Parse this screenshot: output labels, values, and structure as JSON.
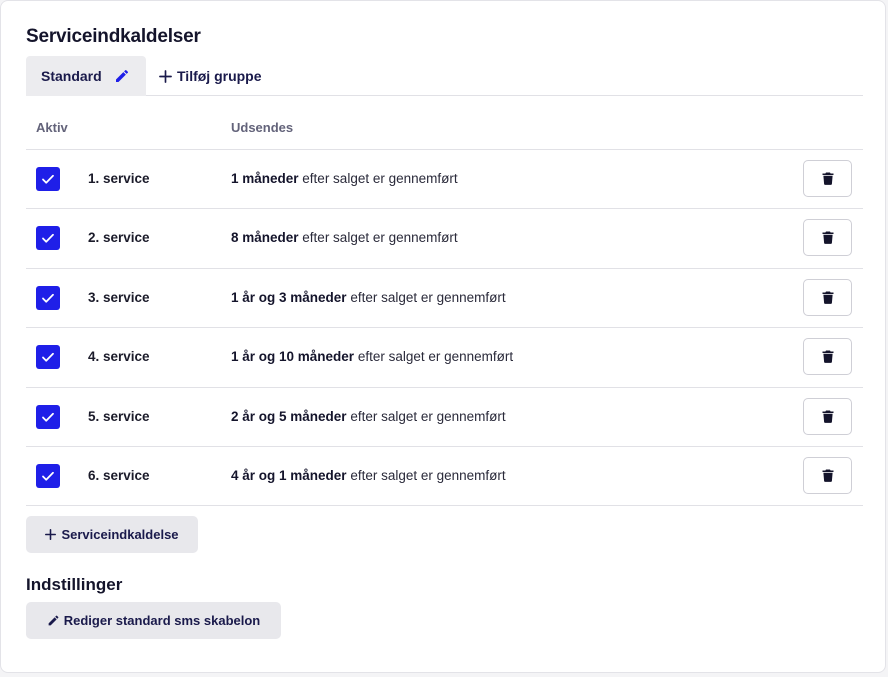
{
  "page": {
    "title": "Serviceindkaldelser"
  },
  "tabs": {
    "active_label": "Standard",
    "add_group_label": "Tilføj gruppe"
  },
  "table": {
    "headers": {
      "active": "Aktiv",
      "sends": "Udsendes"
    },
    "rows": [
      {
        "name": "1. service",
        "interval": "1 måneder",
        "suffix": " efter salget er gennemført",
        "active": true
      },
      {
        "name": "2. service",
        "interval": "8 måneder",
        "suffix": " efter salget er gennemført",
        "active": true
      },
      {
        "name": "3. service",
        "interval": "1 år og 3 måneder",
        "suffix": " efter salget er gennemført",
        "active": true
      },
      {
        "name": "4. service",
        "interval": "1 år og 10 måneder",
        "suffix": " efter salget er gennemført",
        "active": true
      },
      {
        "name": "5. service",
        "interval": "2 år og 5 måneder",
        "suffix": " efter salget er gennemført",
        "active": true
      },
      {
        "name": "6. service",
        "interval": "4 år og 1 måneder",
        "suffix": " efter salget er gennemført",
        "active": true
      }
    ]
  },
  "actions": {
    "add_service_label": "Serviceindkaldelse"
  },
  "settings": {
    "title": "Indstillinger",
    "edit_sms_label": "Rediger standard sms skabelon"
  },
  "colors": {
    "accent": "#1f1fe8",
    "text": "#1a1a4b"
  },
  "icons": {
    "edit": "pencil-icon",
    "add": "plus-icon",
    "delete": "trash-icon",
    "check": "check-icon"
  }
}
